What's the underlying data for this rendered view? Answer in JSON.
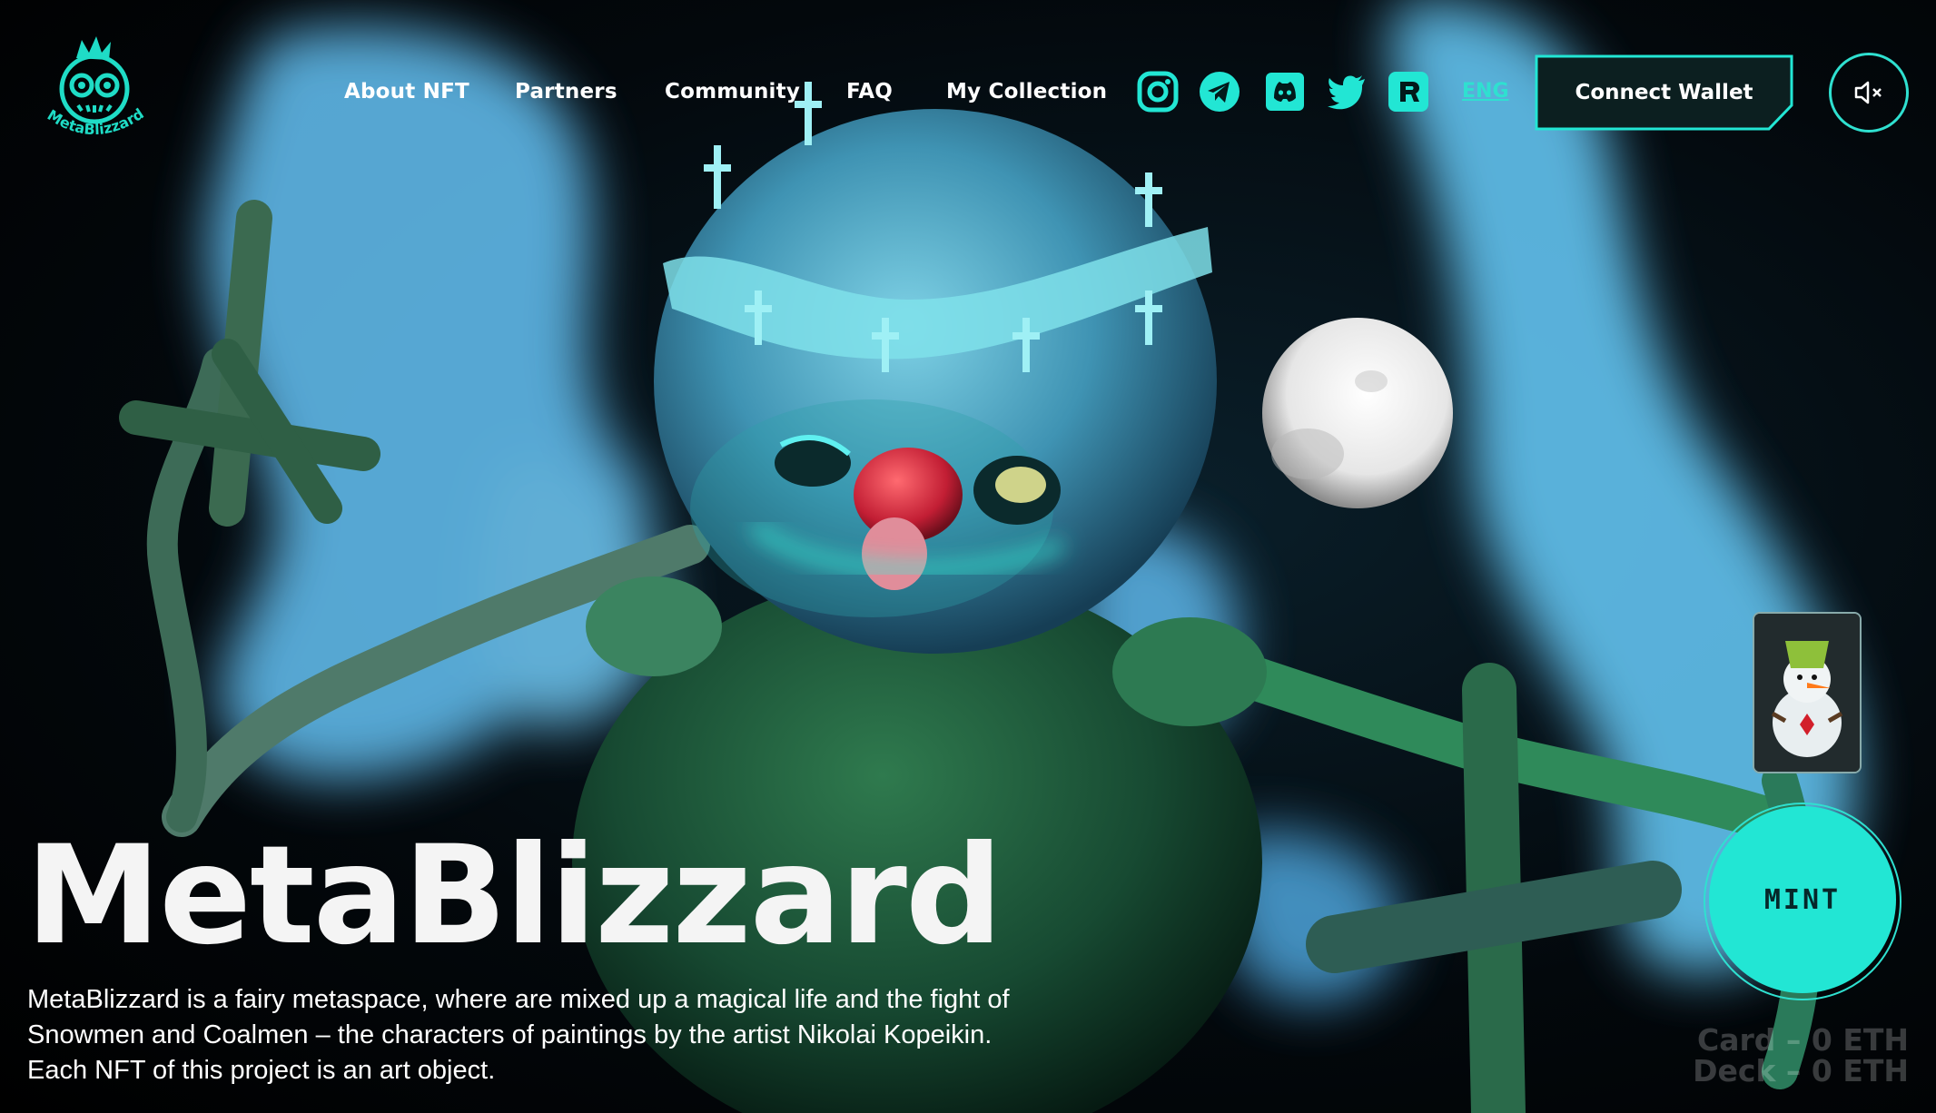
{
  "brand": {
    "logo_text": "MetaBlizzard"
  },
  "nav": {
    "items": [
      {
        "label": "About NFT"
      },
      {
        "label": "Partners"
      },
      {
        "label": "Community"
      },
      {
        "label": "FAQ"
      },
      {
        "label": "My Collection"
      }
    ],
    "socials": [
      "instagram-icon",
      "telegram-icon",
      "discord-icon",
      "twitter-icon",
      "rarible-icon"
    ],
    "language": "ENG",
    "connect_wallet": "Connect Wallet",
    "sound_icon": "speaker-muted-icon"
  },
  "hero": {
    "title": "MetaBlizzard",
    "description_lines": [
      "MetaBlizzard is a fairy metaspace, where are mixed up a magical life and the fight of",
      "Snowmen and Coalmen – the characters of paintings by the artist Nikolai Kopeikin.",
      "Each NFT of this project is an art object."
    ]
  },
  "mint": {
    "label": "MINT",
    "card_price": "Card – 0 ETH",
    "deck_price": "Deck – 0 ETH"
  },
  "colors": {
    "accent": "#22e6d4",
    "background": "#000000",
    "wallet_bg": "#0c1f20",
    "text": "#ffffff"
  }
}
